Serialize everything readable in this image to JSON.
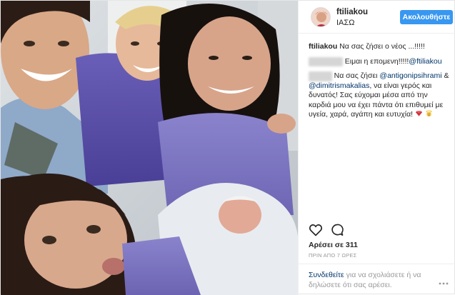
{
  "post": {
    "username": "ftiliakou",
    "location": "ΙΑΣΩ",
    "follow_label": "Ακολουθήστε"
  },
  "comments": [
    {
      "user": "ftiliakou",
      "text": "Να σας ζήσει ο νέος ...!!!!!",
      "blurred_user": false
    },
    {
      "user": "jennykaxl",
      "text": "Ειμαι η επομενη!!!!!",
      "mention": "@ftiliakou",
      "blurred_user": true
    },
    {
      "user": "lelafilk",
      "text_prefix": "Να σας ζήσει",
      "mention1": "@antigonipsihrami",
      "and": "&",
      "mention2": "@dimitrismakalias",
      "text_suffix": ", να είναι γερός και δυνατός! Σας εύχομαι μέσα από την καρδιά μου να έχει πάντα ότι επιθυμεί με υγεία, χαρά, αγάπη και ευτυχία!",
      "blurred_user": true
    }
  ],
  "actions": {
    "like_icon": "heart-outline-icon",
    "comment_icon": "speech-bubble-icon"
  },
  "likes_text": "Αρέσει σε 311",
  "time_text": "ΠΡΙΝ ΑΠΟ 7 ΩΡΕΣ",
  "footer": {
    "login_link": "Συνδεθείτε",
    "rest": " για να σχολιάσετε ή να δηλώσετε ότι σας αρέσει."
  },
  "colors": {
    "accent": "#3897f0",
    "link": "#003569",
    "muted": "#999999",
    "border": "#efefef"
  }
}
